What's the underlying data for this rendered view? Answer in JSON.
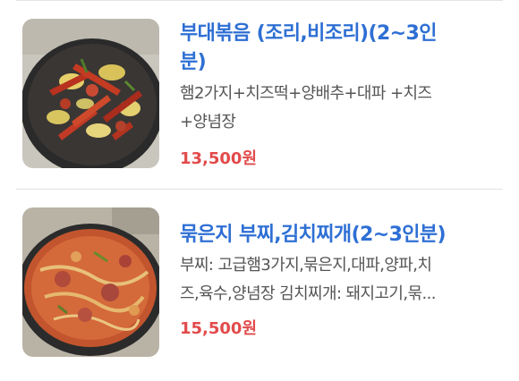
{
  "menu": {
    "items": [
      {
        "title": "부대볶음 (조리,비조리)(2~3인\n분)",
        "description": "햄2가지+치즈떡+양배추+대파 +치즈\n+양념장",
        "price": "13,500원",
        "image": "budae-bokkeum-photo"
      },
      {
        "title": "묶은지 부찌,김치찌개(2~3인분)",
        "description": "부찌: 고급햄3가지,묶은지,대파,양파,치\n즈,육수,양념장 김치찌개: 돼지고기,묶...",
        "price": "15,500원",
        "image": "stew-photo"
      }
    ]
  },
  "colors": {
    "title": "#2e6fd4",
    "price": "#e24b4b",
    "description": "#555555"
  }
}
